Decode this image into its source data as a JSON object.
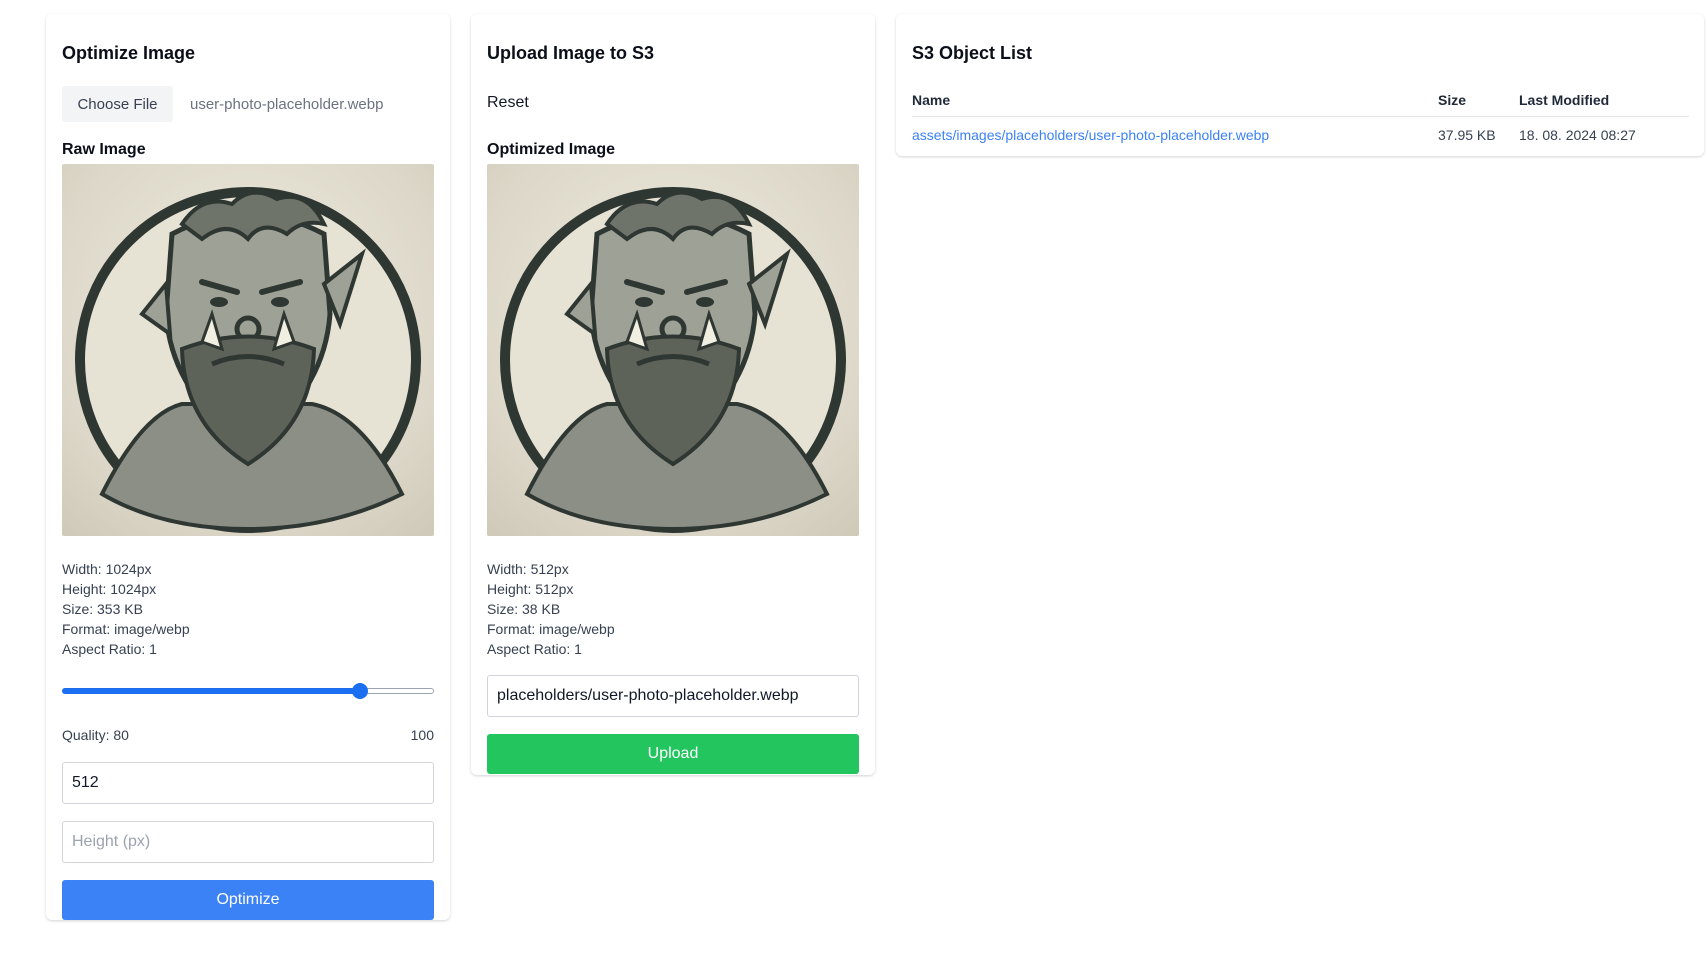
{
  "optimize": {
    "title": "Optimize Image",
    "choose_file_label": "Choose File",
    "file_name": "user-photo-placeholder.webp",
    "raw_image_title": "Raw Image",
    "meta": {
      "width": "Width: 1024px",
      "height": "Height: 1024px",
      "size": "Size: 353 KB",
      "format": "Format: image/webp",
      "aspect": "Aspect Ratio: 1"
    },
    "quality": {
      "value": 80,
      "max": 100,
      "label": "Quality: 80",
      "max_label": "100"
    },
    "width_value": "512",
    "height_placeholder": "Height (px)",
    "optimize_label": "Optimize"
  },
  "upload": {
    "title": "Upload Image to S3",
    "reset_label": "Reset",
    "optimized_image_title": "Optimized Image",
    "meta": {
      "width": "Width: 512px",
      "height": "Height: 512px",
      "size": "Size: 38 KB",
      "format": "Format: image/webp",
      "aspect": "Aspect Ratio: 1"
    },
    "path_value": "placeholders/user-photo-placeholder.webp",
    "upload_label": "Upload"
  },
  "s3": {
    "title": "S3 Object List",
    "columns": [
      "Name",
      "Size",
      "Last Modified"
    ],
    "rows": [
      {
        "name": "assets/images/placeholders/user-photo-placeholder.webp",
        "size": "37.95 KB",
        "modified": "18. 08. 2024 08:27"
      }
    ]
  },
  "colors": {
    "primary": "#3b82f6",
    "success": "#22c55e",
    "slider": "#1d6ff2"
  },
  "icons": {
    "image": "orc-portrait-image"
  }
}
